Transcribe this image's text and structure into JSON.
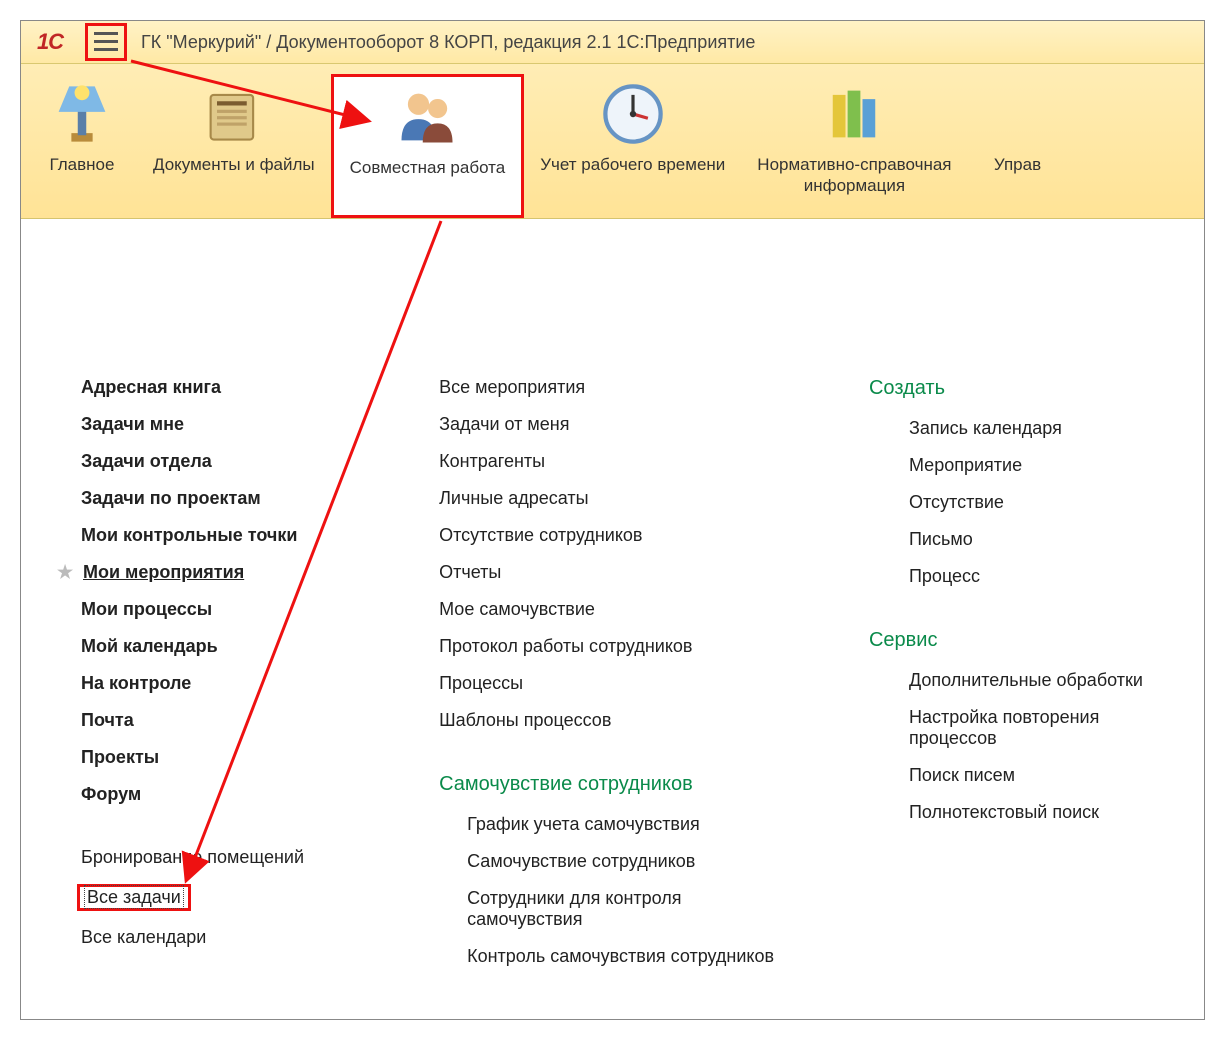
{
  "header": {
    "title": "ГК \"Меркурий\" / Документооборот 8 КОРП, редакция 2.1 1С:Предприятие"
  },
  "sections": [
    {
      "label": "Главное",
      "icon": "lamp-icon"
    },
    {
      "label": "Документы и файлы",
      "icon": "folder-icon"
    },
    {
      "label": "Совместная работа",
      "icon": "people-icon",
      "active": true
    },
    {
      "label": "Учет рабочего времени",
      "icon": "clock-icon"
    },
    {
      "label": "Нормативно-справочная\nинформация",
      "icon": "books-icon"
    },
    {
      "label": "Управ",
      "icon": "",
      "truncated": true
    }
  ],
  "col1_primary": [
    "Адресная книга",
    "Задачи мне",
    "Задачи отдела",
    "Задачи по проектам",
    "Мои контрольные точки",
    "Мои мероприятия",
    "Мои процессы",
    "Мой календарь",
    "На контроле",
    "Почта",
    "Проекты",
    "Форум"
  ],
  "col1_starred_index": 5,
  "col1_secondary": [
    "Бронирование помещений",
    "Все задачи",
    "Все календари"
  ],
  "col1_secondary_highlight_index": 1,
  "col2_links": [
    "Все мероприятия",
    "Задачи от меня",
    "Контрагенты",
    "Личные адресаты",
    "Отсутствие сотрудников",
    "Отчеты",
    "Мое самочувствие",
    "Протокол работы сотрудников",
    "Процессы",
    "Шаблоны процессов"
  ],
  "col2_group_title": "Самочувствие сотрудников",
  "col2_group_links": [
    "График учета самочувствия",
    "Самочувствие сотрудников",
    "Сотрудники для контроля самочувствия",
    "Контроль самочувствия сотрудников"
  ],
  "col3_create_title": "Создать",
  "col3_create_links": [
    "Запись календаря",
    "Мероприятие",
    "Отсутствие",
    "Письмо",
    "Процесс"
  ],
  "col3_service_title": "Сервис",
  "col3_service_links": [
    "Дополнительные обработки",
    "Настройка повторения процессов",
    "Поиск писем",
    "Полнотекстовый поиск"
  ]
}
